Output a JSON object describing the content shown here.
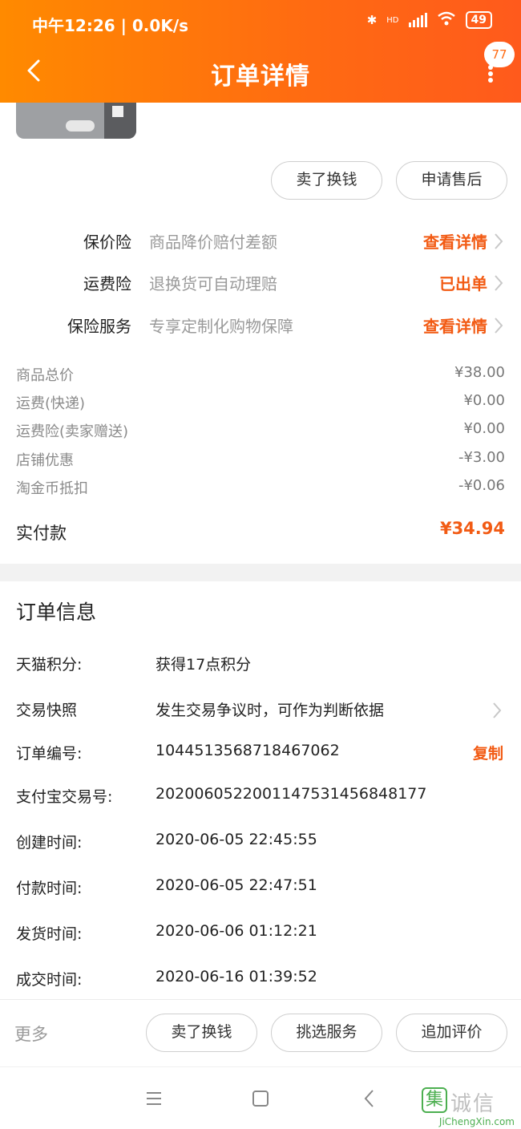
{
  "status": {
    "time_speed": "中午12:26 | 0.0K/s",
    "network": "HD",
    "battery": "49"
  },
  "header": {
    "title": "订单详情",
    "badge": "77"
  },
  "actions_top": {
    "sell_label": "卖了换钱",
    "after_sale_label": "申请售后"
  },
  "insurance": [
    {
      "label": "保价险",
      "desc": "商品降价赔付差额",
      "action": "查看详情"
    },
    {
      "label": "运费险",
      "desc": "退换货可自动理赔",
      "action": "已出单"
    },
    {
      "label": "保险服务",
      "desc": "专享定制化购物保障",
      "action": "查看详情"
    }
  ],
  "prices": [
    {
      "label": "商品总价",
      "value": "¥38.00"
    },
    {
      "label": "运费(快递)",
      "value": "¥0.00"
    },
    {
      "label": "运费险(卖家赠送)",
      "value": "¥0.00"
    },
    {
      "label": "店铺优惠",
      "value": "-¥3.00"
    },
    {
      "label": "淘金币抵扣",
      "value": "-¥0.06"
    }
  ],
  "paid": {
    "label": "实付款",
    "value": "¥34.94"
  },
  "order_info": {
    "title": "订单信息",
    "rows": [
      {
        "label": "天猫积分:",
        "value": "获得17点积分"
      },
      {
        "label": "交易快照",
        "value": "发生交易争议时，可作为判断依据"
      },
      {
        "label": "订单编号:",
        "value": "1044513568718467062",
        "action": "复制"
      },
      {
        "label": "支付宝交易号:",
        "value": "2020060522001147531456848177"
      },
      {
        "label": "创建时间:",
        "value": "2020-06-05 22:45:55"
      },
      {
        "label": "付款时间:",
        "value": "2020-06-05 22:47:51"
      },
      {
        "label": "发货时间:",
        "value": "2020-06-06 01:12:21"
      },
      {
        "label": "成交时间:",
        "value": "2020-06-16 01:39:52"
      }
    ]
  },
  "bottom_bar": {
    "more_label": "更多",
    "buttons": [
      "卖了换钱",
      "挑选服务",
      "追加评价"
    ]
  },
  "watermark": {
    "logo_char": "集",
    "text": "诚信",
    "url": "JiChengXin.com"
  },
  "colors": {
    "header_gradient_start": "#ff8a00",
    "header_gradient_end": "#ff5a1c",
    "accent": "#f25b14"
  }
}
